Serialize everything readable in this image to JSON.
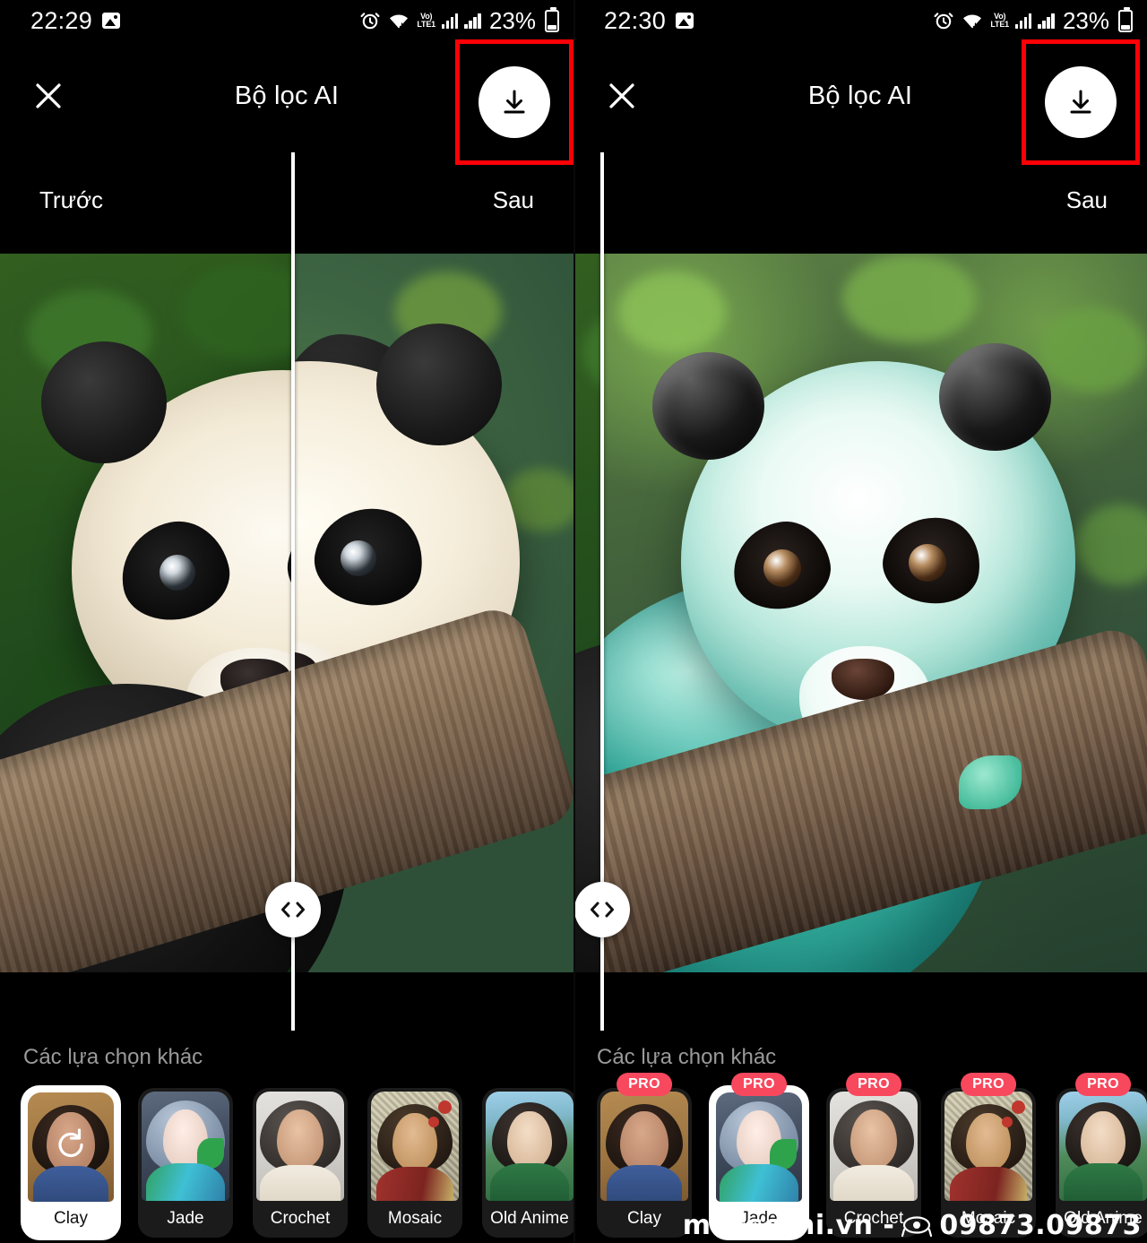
{
  "panels": [
    {
      "status_bar": {
        "time": "22:29",
        "photo_icon": "image-icon",
        "alarm_icon": "alarm-icon",
        "wifi_icon": "wifi-icon",
        "volte_label_top": "Vo)",
        "volte_label_bottom": "LTE1",
        "signal_icon_1": "signal-bars-icon",
        "signal_icon_2": "signal-bars-icon",
        "battery_percent": "23%",
        "battery_icon": "battery-icon"
      },
      "app_bar": {
        "close_icon": "close-icon",
        "title": "Bộ lọc AI",
        "download_icon": "download-icon",
        "highlight_color": "#fb0007"
      },
      "compare": {
        "before_label": "Trước",
        "after_label": "Sau",
        "handle_icon": "left-right-chevrons-icon",
        "split_percent": 51
      },
      "options": {
        "title": "Các lựa chọn khác",
        "cards": [
          {
            "label": "Clay",
            "selected": true,
            "pro": false,
            "overlay_icon": "refresh-icon",
            "thumb": "th-clay"
          },
          {
            "label": "Jade",
            "selected": false,
            "pro": false,
            "overlay_icon": "",
            "thumb": "th-jade"
          },
          {
            "label": "Crochet",
            "selected": false,
            "pro": false,
            "overlay_icon": "",
            "thumb": "th-crochet"
          },
          {
            "label": "Mosaic",
            "selected": false,
            "pro": false,
            "overlay_icon": "",
            "thumb": "th-mosaic"
          },
          {
            "label": "Old Anime",
            "selected": false,
            "pro": false,
            "overlay_icon": "",
            "thumb": "th-anime"
          }
        ]
      }
    },
    {
      "status_bar": {
        "time": "22:30",
        "photo_icon": "image-icon",
        "alarm_icon": "alarm-icon",
        "wifi_icon": "wifi-icon",
        "volte_label_top": "Vo)",
        "volte_label_bottom": "LTE1",
        "signal_icon_1": "signal-bars-icon",
        "signal_icon_2": "signal-bars-icon",
        "battery_percent": "23%",
        "battery_icon": "battery-icon"
      },
      "app_bar": {
        "close_icon": "close-icon",
        "title": "Bộ lọc AI",
        "download_icon": "download-icon",
        "highlight_color": "#fb0007"
      },
      "compare": {
        "before_label": "",
        "after_label": "Sau",
        "handle_icon": "left-right-chevrons-icon",
        "split_percent": 5
      },
      "options": {
        "title": "Các lựa chọn khác",
        "pro_badge_label": "PRO",
        "pro_badge_color": "#f8485e",
        "cards": [
          {
            "label": "Clay",
            "selected": false,
            "pro": true,
            "overlay_icon": "",
            "thumb": "th-clay"
          },
          {
            "label": "Jade",
            "selected": true,
            "pro": true,
            "overlay_icon": "",
            "thumb": "th-jade"
          },
          {
            "label": "Crochet",
            "selected": false,
            "pro": true,
            "overlay_icon": "",
            "thumb": "th-crochet"
          },
          {
            "label": "Mosaic",
            "selected": false,
            "pro": true,
            "overlay_icon": "",
            "thumb": "th-mosaic"
          },
          {
            "label": "Old Anime",
            "selected": false,
            "pro": true,
            "overlay_icon": "",
            "thumb": "th-anime"
          }
        ]
      }
    }
  ],
  "watermark": {
    "site": "mucsothi.vn -",
    "phone_icon": "telephone-icon",
    "phone": "09873.09873"
  }
}
